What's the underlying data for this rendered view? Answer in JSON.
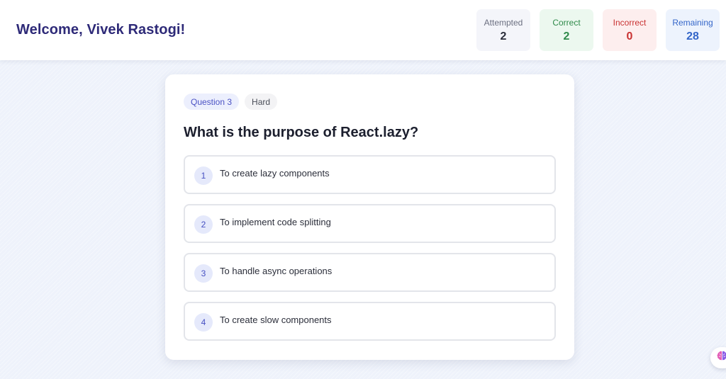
{
  "header": {
    "welcome": "Welcome, Vivek Rastogi!",
    "stats": {
      "attempted": {
        "label": "Attempted",
        "value": "2"
      },
      "correct": {
        "label": "Correct",
        "value": "2"
      },
      "incorrect": {
        "label": "Incorrect",
        "value": "0"
      },
      "remaining": {
        "label": "Remaining",
        "value": "28"
      }
    }
  },
  "question": {
    "number_label": "Question 3",
    "difficulty": "Hard",
    "title": "What is the purpose of React.lazy?",
    "options": [
      {
        "num": "1",
        "text": "To create lazy components"
      },
      {
        "num": "2",
        "text": "To implement code splitting"
      },
      {
        "num": "3",
        "text": "To handle async operations"
      },
      {
        "num": "4",
        "text": "To create slow components"
      }
    ]
  },
  "assistant": {
    "icon": "brain-icon"
  },
  "colors": {
    "brand_title": "#2e2a78",
    "correct": "#2f8a4a",
    "incorrect": "#c93232",
    "remaining": "#3466c9",
    "accent": "#4650c2"
  }
}
